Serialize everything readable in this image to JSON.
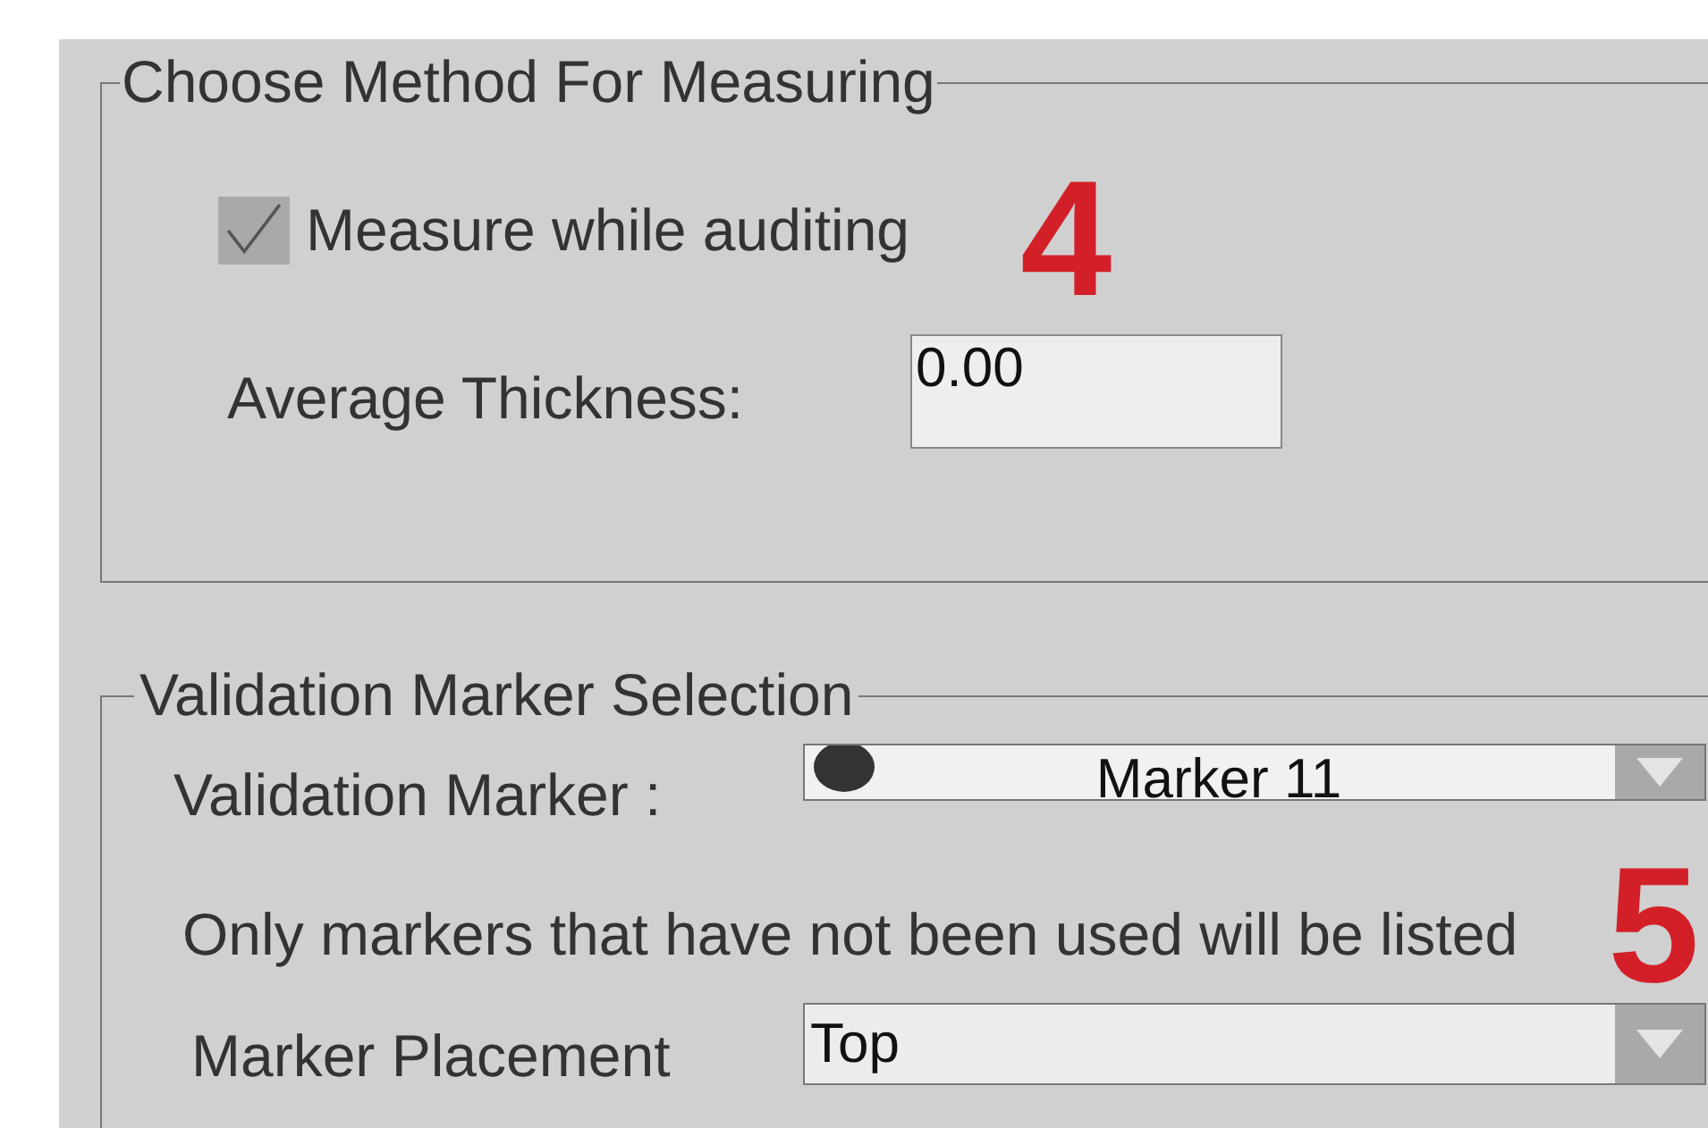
{
  "measuring": {
    "title": "Choose Method For Measuring",
    "checkbox": {
      "label": "Measure while auditing",
      "checked": true,
      "disabled": true
    },
    "annotation": "4",
    "thickness": {
      "label": "Average Thickness:",
      "value": "0.00"
    }
  },
  "marker_selection": {
    "title": "Validation Marker Selection",
    "marker": {
      "label": "Validation Marker :",
      "value": "Marker 11"
    },
    "note": "Only markers that have not been used will be listed",
    "annotation": "5",
    "placement": {
      "label": "Marker Placement",
      "value": "Top"
    }
  }
}
